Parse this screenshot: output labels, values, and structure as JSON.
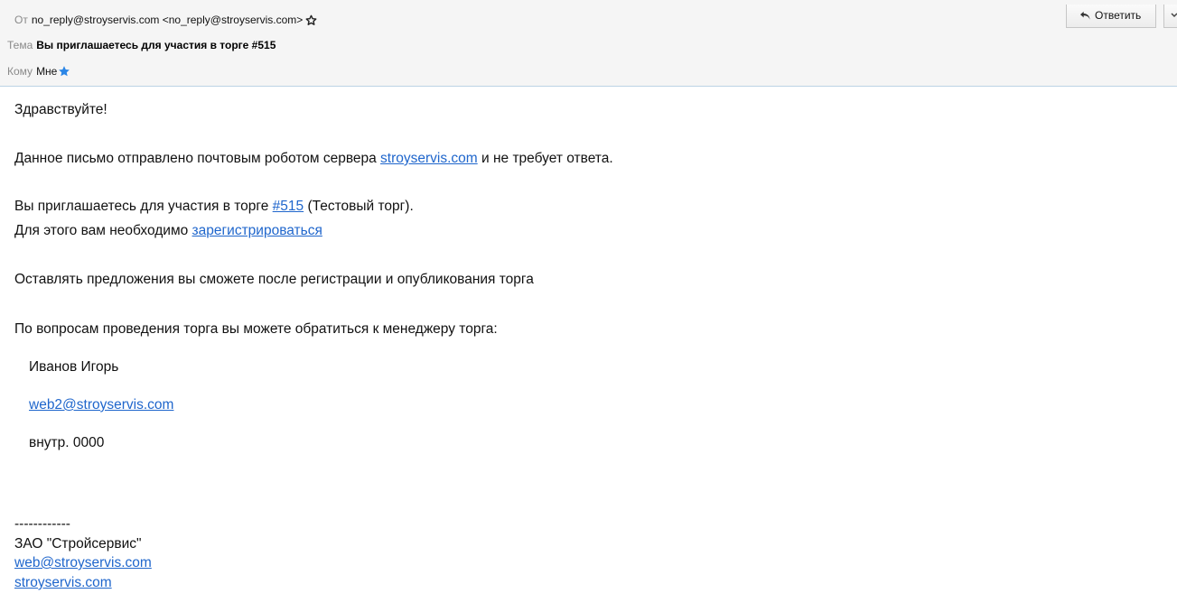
{
  "header": {
    "from_label": "От",
    "from_value": "no_reply@stroyservis.com <no_reply@stroyservis.com>",
    "subject_label": "Тема",
    "subject_value": "Вы приглашаетесь для участия в торге #515",
    "to_label": "Кому",
    "to_value": "Мне",
    "reply_label": "Ответить"
  },
  "message": {
    "greeting": "Здравствуйте!",
    "line1_before": "Данное письмо отправлено почтовым роботом сервера ",
    "line1_link": "stroyservis.com",
    "line1_after": " и не требует ответа.",
    "line2_before": "Вы приглашаетесь для участия в торге ",
    "line2_link": "#515",
    "line2_after": " (Тестовый торг).",
    "line3_before": "Для этого вам необходимо ",
    "line3_link": "зарегистрироваться",
    "line4": "Оставлять предложения вы сможете после регистрации и опубликования торга",
    "line5": "По вопросам проведения торга вы можете обратиться к менеджеру торга:",
    "manager_name": "Иванов Игорь",
    "manager_email": "web2@stroyservis.com",
    "manager_ext": "внутр. 0000",
    "separator": "------------",
    "company": "ЗАО \"Стройсервис\"",
    "company_email": "web@stroyservis.com",
    "company_site": "stroyservis.com"
  },
  "colors": {
    "link": "#1f66cc",
    "star_blue": "#2b86e6",
    "header_bg": "#f5f5f5"
  },
  "icons": {
    "from_star": "star-outline-icon",
    "to_star": "star-filled-icon",
    "reply": "reply-arrow-icon",
    "more": "chevron-down-icon"
  }
}
